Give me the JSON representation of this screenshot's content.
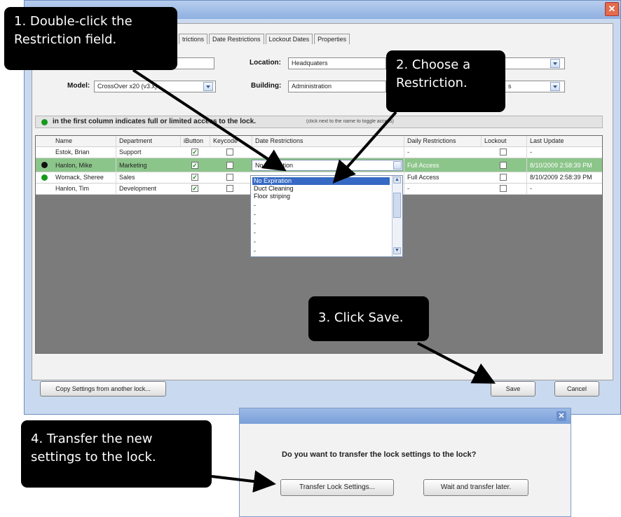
{
  "main_window": {
    "tabs": [
      "trictions",
      "Date Restrictions",
      "Lockout Dates",
      "Properties"
    ],
    "form": {
      "location_label": "Location:",
      "location_value": "Headquaters",
      "model_label": "Model:",
      "model_value": "CrossOver x20 (v3.x)",
      "building_label": "Building:",
      "building_value": "Administration",
      "building_extra_fragment": "s"
    },
    "info_bar": {
      "text_bold": "in the first column indicates full or limited access to the lock.",
      "text_small": "(click next to the name to toggle access)"
    },
    "grid": {
      "columns": [
        "Name",
        "Department",
        "iButton",
        "Keycode",
        "Date Restrictions",
        "Daily Restrictions",
        "Lockout",
        "Last Update"
      ],
      "rows": [
        {
          "name": "Estok, Brian",
          "department": "Support",
          "ibutton": true,
          "keycode": false,
          "date_restriction": "",
          "daily": "-",
          "lockout": false,
          "last_update": "-",
          "status_dot": "none"
        },
        {
          "name": "Hanlon, Mike",
          "department": "Marketing",
          "ibutton": true,
          "keycode": false,
          "date_restriction": "No Expiration",
          "daily": "Full Access",
          "lockout": false,
          "last_update": "8/10/2009 2:58:39 PM",
          "status_dot": "black"
        },
        {
          "name": "Womack, Sheree",
          "department": "Sales",
          "ibutton": true,
          "keycode": false,
          "date_restriction": "",
          "daily": "Full Access",
          "lockout": false,
          "last_update": "8/10/2009 2:58:39 PM",
          "status_dot": "green"
        },
        {
          "name": "Hanlon, Tim",
          "department": "Development",
          "ibutton": true,
          "keycode": false,
          "date_restriction": "",
          "daily": "-",
          "lockout": false,
          "last_update": "-",
          "status_dot": "none"
        }
      ]
    },
    "date_dropdown": {
      "selected": "No Expiration",
      "options": [
        "No Expiration",
        "Duct Cleaning",
        "Floor striping",
        "-",
        "-",
        "-",
        "-",
        "-",
        "-"
      ]
    },
    "buttons": {
      "copy_settings": "Copy Settings from another lock...",
      "save": "Save",
      "cancel": "Cancel"
    }
  },
  "dialog": {
    "question": "Do you want to transfer the lock settings to the lock?",
    "transfer_button": "Transfer Lock Settings...",
    "wait_button": "Wait and transfer later."
  },
  "callouts": {
    "step1": [
      "1. Double-click the",
      "Restriction field."
    ],
    "step2": [
      "2. Choose a",
      "Restriction."
    ],
    "step3": "3. Click Save.",
    "step4": [
      "4. Transfer the new",
      "settings to the lock."
    ]
  },
  "colors": {
    "selected_row": "#8cc58a",
    "status_green": "#169a1a",
    "highlight_option": "#3569c4",
    "titlebar": "#8fb0e0"
  }
}
